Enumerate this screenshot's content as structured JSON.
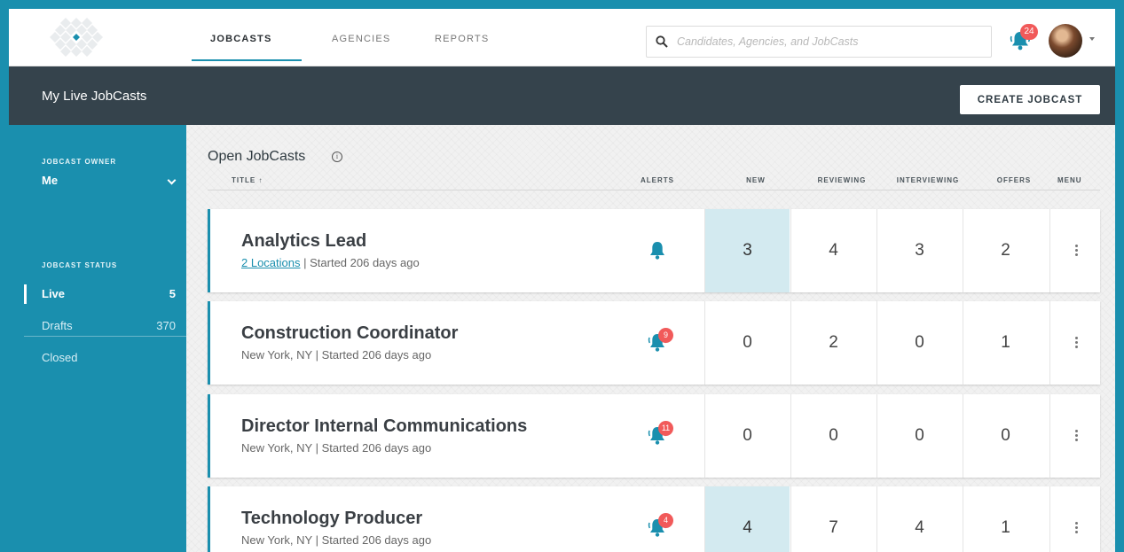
{
  "nav": {
    "tabs": [
      {
        "label": "JOBCASTS",
        "active": true
      },
      {
        "label": "AGENCIES",
        "active": false
      },
      {
        "label": "REPORTS",
        "active": false
      }
    ],
    "search_placeholder": "Candidates, Agencies, and JobCasts",
    "notification_count": "24",
    "accent_color": "#1a8fae",
    "badge_color": "#f15a5a"
  },
  "header": {
    "title": "My Live JobCasts",
    "create_label": "CREATE JOBCAST"
  },
  "sidebar": {
    "owner_heading": "JOBCAST OWNER",
    "owner_value": "Me",
    "status_heading": "JOBCAST STATUS",
    "statuses": [
      {
        "label": "Live",
        "count": "5",
        "active": true
      },
      {
        "label": "Drafts",
        "count": "370",
        "active": false
      },
      {
        "label": "Closed",
        "count": "",
        "active": false
      }
    ]
  },
  "main": {
    "title": "Open JobCasts",
    "columns": {
      "title": "TITLE ↑",
      "alerts": "ALERTS",
      "new": "NEW",
      "reviewing": "REVIEWING",
      "interviewing": "INTERVIEWING",
      "offers": "OFFERS",
      "menu": "MENU"
    },
    "rows": [
      {
        "title": "Analytics Lead",
        "location": "2 Locations",
        "location_link": true,
        "started": "| Started 206 days ago",
        "alert_icon": "bell-icon",
        "alert_count": "",
        "new": "3",
        "reviewing": "4",
        "interviewing": "3",
        "offers": "2",
        "highlight_new": true
      },
      {
        "title": "Construction Coordinator",
        "location": "New York, NY",
        "location_link": false,
        "started": "| Started 206 days ago",
        "alert_icon": "bell-ringing-icon",
        "alert_count": "9",
        "new": "0",
        "reviewing": "2",
        "interviewing": "0",
        "offers": "1",
        "highlight_new": false
      },
      {
        "title": "Director Internal Communications",
        "location": "New York, NY",
        "location_link": false,
        "started": "| Started 206 days ago",
        "alert_icon": "bell-ringing-icon",
        "alert_count": "11",
        "new": "0",
        "reviewing": "0",
        "interviewing": "0",
        "offers": "0",
        "highlight_new": false
      },
      {
        "title": "Technology Producer",
        "location": "New York, NY",
        "location_link": false,
        "started": "| Started 206 days ago",
        "alert_icon": "bell-ringing-icon",
        "alert_count": "4",
        "new": "4",
        "reviewing": "7",
        "interviewing": "4",
        "offers": "1",
        "highlight_new": true
      }
    ]
  }
}
